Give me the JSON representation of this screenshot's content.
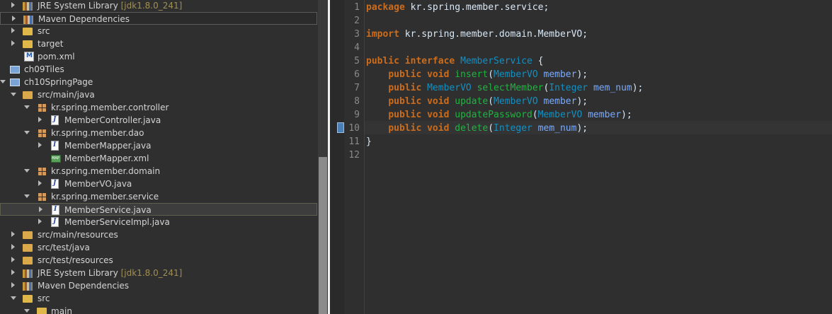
{
  "tree": {
    "rows": [
      {
        "label": "JRE System Library",
        "deco": "[jdk1.8.0_241]"
      },
      {
        "label": "Maven Dependencies"
      },
      {
        "label": "src"
      },
      {
        "label": "target"
      },
      {
        "label": "pom.xml"
      },
      {
        "label": "ch09Tiles"
      },
      {
        "label": "ch10SpringPage"
      },
      {
        "label": "src/main/java"
      },
      {
        "label": "kr.spring.member.controller"
      },
      {
        "label": "MemberController.java"
      },
      {
        "label": "kr.spring.member.dao"
      },
      {
        "label": "MemberMapper.java"
      },
      {
        "label": "MemberMapper.xml"
      },
      {
        "label": "kr.spring.member.domain"
      },
      {
        "label": "MemberVO.java"
      },
      {
        "label": "kr.spring.member.service"
      },
      {
        "label": "MemberService.java"
      },
      {
        "label": "MemberServiceImpl.java"
      },
      {
        "label": "src/main/resources"
      },
      {
        "label": "src/test/java"
      },
      {
        "label": "src/test/resources"
      },
      {
        "label": "JRE System Library",
        "deco": "[jdk1.8.0_241]"
      },
      {
        "label": "Maven Dependencies"
      },
      {
        "label": "src"
      },
      {
        "label": "main"
      }
    ]
  },
  "editor": {
    "line_numbers": [
      "1",
      "2",
      "3",
      "4",
      "5",
      "6",
      "7",
      "8",
      "9",
      "10",
      "11",
      "12"
    ],
    "lines": [
      [
        {
          "t": "package",
          "c": "kw"
        },
        {
          "t": " kr.spring.member.service;",
          "c": "pl"
        }
      ],
      [],
      [
        {
          "t": "import",
          "c": "kw"
        },
        {
          "t": " kr.spring.member.domain.MemberVO;",
          "c": "pl"
        }
      ],
      [],
      [
        {
          "t": "public",
          "c": "kw"
        },
        {
          "t": " ",
          "c": "pl"
        },
        {
          "t": "interface",
          "c": "kw"
        },
        {
          "t": " ",
          "c": "pl"
        },
        {
          "t": "MemberService",
          "c": "ty"
        },
        {
          "t": " {",
          "c": "pl"
        }
      ],
      [
        {
          "t": "    ",
          "c": "pl"
        },
        {
          "t": "public",
          "c": "kw"
        },
        {
          "t": " ",
          "c": "pl"
        },
        {
          "t": "void",
          "c": "kw"
        },
        {
          "t": " ",
          "c": "pl"
        },
        {
          "t": "insert",
          "c": "fn"
        },
        {
          "t": "(",
          "c": "pl"
        },
        {
          "t": "MemberVO",
          "c": "ty"
        },
        {
          "t": " ",
          "c": "pl"
        },
        {
          "t": "member",
          "c": "va"
        },
        {
          "t": ");",
          "c": "pl"
        }
      ],
      [
        {
          "t": "    ",
          "c": "pl"
        },
        {
          "t": "public",
          "c": "kw"
        },
        {
          "t": " ",
          "c": "pl"
        },
        {
          "t": "MemberVO",
          "c": "ty"
        },
        {
          "t": " ",
          "c": "pl"
        },
        {
          "t": "selectMember",
          "c": "fn"
        },
        {
          "t": "(",
          "c": "pl"
        },
        {
          "t": "Integer",
          "c": "ty"
        },
        {
          "t": " ",
          "c": "pl"
        },
        {
          "t": "mem_num",
          "c": "va"
        },
        {
          "t": ");",
          "c": "pl"
        }
      ],
      [
        {
          "t": "    ",
          "c": "pl"
        },
        {
          "t": "public",
          "c": "kw"
        },
        {
          "t": " ",
          "c": "pl"
        },
        {
          "t": "void",
          "c": "kw"
        },
        {
          "t": " ",
          "c": "pl"
        },
        {
          "t": "update",
          "c": "fn"
        },
        {
          "t": "(",
          "c": "pl"
        },
        {
          "t": "MemberVO",
          "c": "ty"
        },
        {
          "t": " ",
          "c": "pl"
        },
        {
          "t": "member",
          "c": "va"
        },
        {
          "t": ");",
          "c": "pl"
        }
      ],
      [
        {
          "t": "    ",
          "c": "pl"
        },
        {
          "t": "public",
          "c": "kw"
        },
        {
          "t": " ",
          "c": "pl"
        },
        {
          "t": "void",
          "c": "kw"
        },
        {
          "t": " ",
          "c": "pl"
        },
        {
          "t": "updatePassword",
          "c": "fn"
        },
        {
          "t": "(",
          "c": "pl"
        },
        {
          "t": "MemberVO",
          "c": "ty"
        },
        {
          "t": " ",
          "c": "pl"
        },
        {
          "t": "member",
          "c": "va"
        },
        {
          "t": ");",
          "c": "pl"
        }
      ],
      [
        {
          "t": "    ",
          "c": "pl"
        },
        {
          "t": "public",
          "c": "kw"
        },
        {
          "t": " ",
          "c": "pl"
        },
        {
          "t": "void",
          "c": "kw"
        },
        {
          "t": " ",
          "c": "pl"
        },
        {
          "t": "delete",
          "c": "fn"
        },
        {
          "t": "(",
          "c": "pl"
        },
        {
          "t": "Integer",
          "c": "ty"
        },
        {
          "t": " ",
          "c": "pl"
        },
        {
          "t": "mem_num",
          "c": "va"
        },
        {
          "t": ");",
          "c": "pl"
        }
      ],
      [
        {
          "t": "}",
          "c": "pl"
        }
      ],
      []
    ]
  }
}
